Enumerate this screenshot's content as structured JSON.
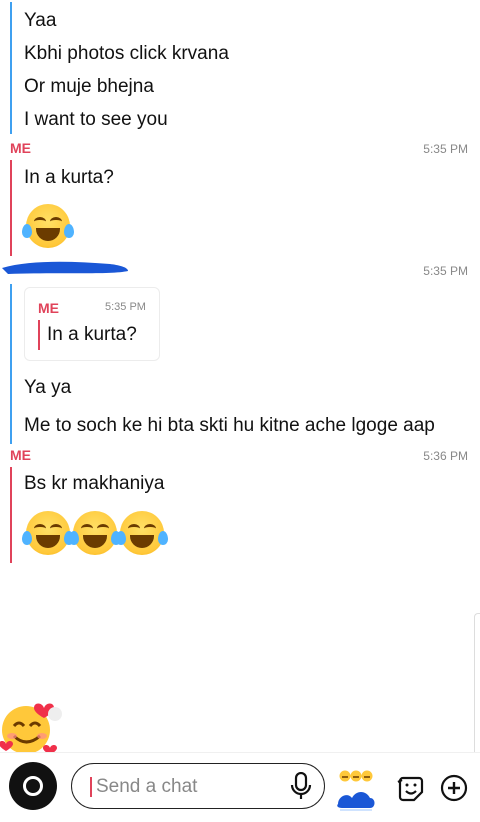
{
  "messages": {
    "incoming_1": [
      "Yaa",
      "Kbhi photos click krvana",
      "Or muje bhejna",
      "I want to see you"
    ],
    "me_1": {
      "sender": "ME",
      "time": "5:35 PM",
      "text": "In a kurta?"
    },
    "incoming_2": {
      "time": "5:35 PM",
      "quote": {
        "sender": "ME",
        "time": "5:35 PM",
        "text": "In a kurta?"
      },
      "lines": [
        "Ya ya",
        "Me to soch ke hi bta skti hu kitne ache lgoge aap"
      ]
    },
    "me_2": {
      "sender": "ME",
      "time": "5:36 PM",
      "text": "Bs kr makhaniya"
    }
  },
  "input": {
    "placeholder": "Send a chat"
  },
  "icons": [
    "camera-icon",
    "microphone-icon",
    "bitmoji-icon",
    "sticker-icon",
    "plus-icon",
    "smiling-face-with-hearts-icon",
    "laughing-tears-icon"
  ],
  "colors": {
    "me": "#e0435a",
    "friend": "#3fa0f0",
    "redaction": "#1a57d6"
  }
}
